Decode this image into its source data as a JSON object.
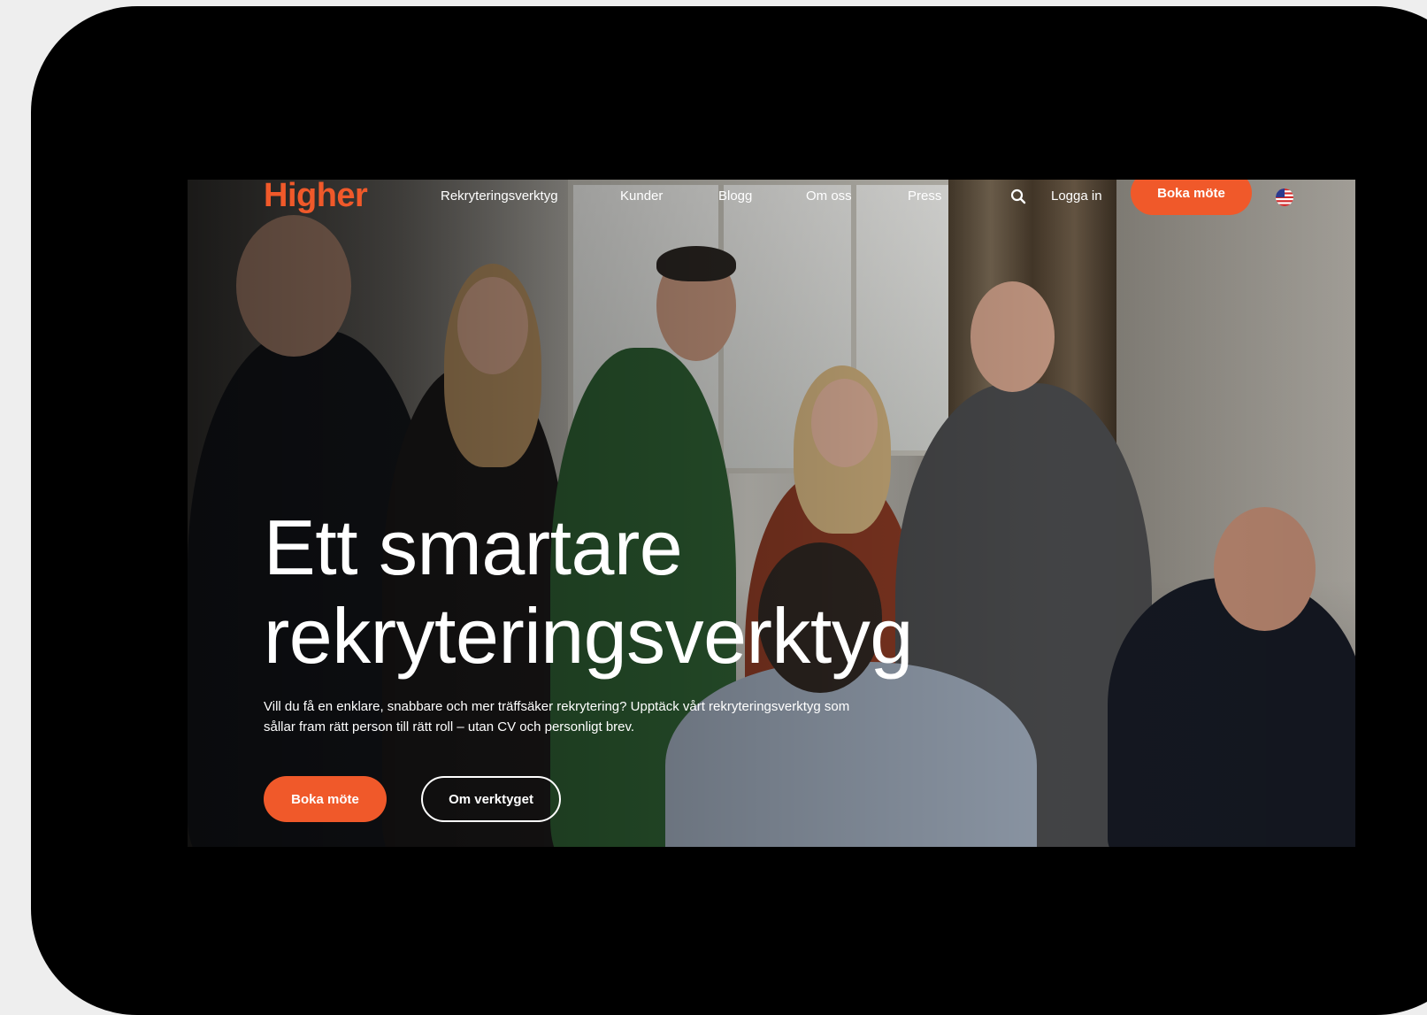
{
  "nav": {
    "logo": "Higher",
    "links": [
      "Rekryteringsverktyg",
      "Kunder",
      "Blogg",
      "Om oss",
      "Press"
    ],
    "login": "Logga in",
    "cta": "Boka möte"
  },
  "hero": {
    "title_line1": "Ett smartare",
    "title_line2": "rekryteringsverktyg",
    "subtitle": "Vill du få en enklare, snabbare och mer träffsäker rekrytering? Upptäck vårt rekryteringsverktyg som sållar fram rätt person till rätt roll – utan CV och personligt brev.",
    "primary_button": "Boka möte",
    "secondary_button": "Om verktyget"
  },
  "colors": {
    "brand": "#f0592a",
    "text_on_photo": "#ffffff",
    "device_frame": "#000000"
  },
  "icons": [
    "search-icon",
    "us-flag-icon"
  ]
}
